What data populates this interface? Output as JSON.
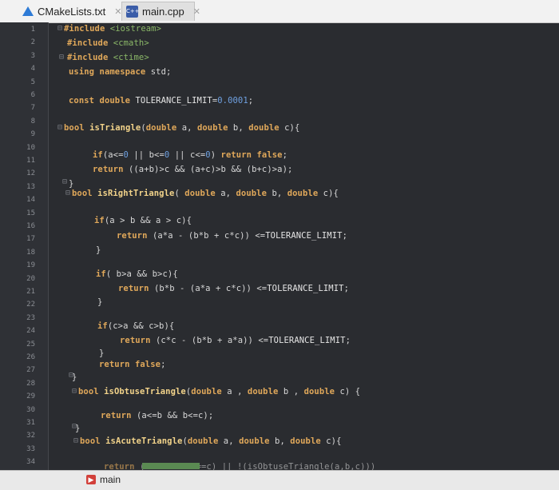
{
  "tabs": [
    {
      "label": "CMakeLists.txt"
    },
    {
      "label": "main.cpp",
      "icon_text": "C++"
    }
  ],
  "gutter": {
    "line_numbers": [
      "1",
      "2",
      "3",
      "4",
      "5",
      "6",
      "7",
      "8",
      "9",
      "10",
      "11",
      "12",
      "13",
      "14",
      "15",
      "16",
      "17",
      "18",
      "19",
      "20",
      "21",
      "22",
      "23",
      "24",
      "25",
      "26",
      "27",
      "28",
      "29",
      "30",
      "31",
      "32",
      "33",
      "34"
    ]
  },
  "editor": {
    "lines": [
      "#include <iostream>",
      "#include <cmath>",
      "#include <ctime>",
      "using namespace std;",
      "const double TOLERANCE_LIMIT=0.0001;",
      "bool isTriangle(double a, double b, double c){",
      "if(a<=0 || b<=0 || c<=0) return false;",
      "return ((a+b)>c && (a+c)>b && (b+c)>a);",
      "}",
      "bool isRightTriangle( double a, double b, double c){",
      "if(a > b && a > c){",
      "return (a*a - (b*b + c*c)) <=TOLERANCE_LIMIT;",
      "}",
      "if( b>a && b>c){",
      "return (b*b - (a*a + c*c)) <=TOLERANCE_LIMIT;",
      "}",
      "if(c>a && c>b){",
      "return (c*c - (b*b + a*a)) <=TOLERANCE_LIMIT;",
      "}",
      "return false;",
      "}",
      "bool isObtuseTriangle(double a , double b , double c) {",
      "return (a<=b && b<=c);",
      "}",
      "bool isAcuteTriangle(double a, double b, double c){",
      "return ( a==b && b==c) || !(isObtuseTriangle(a,b,c)))"
    ]
  },
  "bottom_bar": {
    "run_config": "main"
  },
  "colors": {
    "keyword": "#e0a85a",
    "function": "#f2d38a",
    "number": "#6fa0e0",
    "header": "#8bb868"
  }
}
